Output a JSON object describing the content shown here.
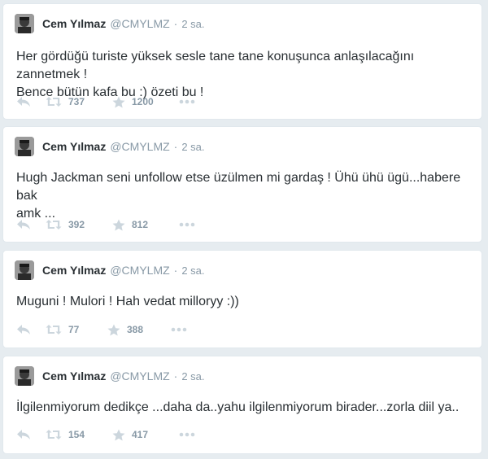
{
  "tweets": [
    {
      "name": "Cem Yılmaz",
      "handle": "@CMYLMZ",
      "separator": "·",
      "time": "2 sa.",
      "text_line1": "Her gördüğü turiste yüksek sesle tane tane konuşunca anlaşılacağını zannetmek !",
      "text_line2": "Bence bütün kafa bu :) özeti bu !",
      "retweets": "737",
      "favorites": "1200"
    },
    {
      "name": "Cem Yılmaz",
      "handle": "@CMYLMZ",
      "separator": "·",
      "time": "2 sa.",
      "text_line1": "Hugh Jackman seni unfollow etse üzülmen mi gardaş ! Ühü ühü ügü...habere bak",
      "text_line2": "amk ...",
      "retweets": "392",
      "favorites": "812"
    },
    {
      "name": "Cem Yılmaz",
      "handle": "@CMYLMZ",
      "separator": "·",
      "time": "2 sa.",
      "text_line1": "Muguni ! Mulori ! Hah vedat milloryy :))",
      "text_line2": "",
      "retweets": "77",
      "favorites": "388"
    },
    {
      "name": "Cem Yılmaz",
      "handle": "@CMYLMZ",
      "separator": "·",
      "time": "2 sa.",
      "text_line1": "İlgilenmiyorum dedikçe ...daha da..yahu ilgilenmiyorum birader...zorla diil ya..",
      "text_line2": "",
      "retweets": "154",
      "favorites": "417"
    }
  ],
  "icons": {
    "avatar": "avatar-photo",
    "reply": "reply-icon",
    "retweet": "retweet-icon",
    "favorite": "star-icon",
    "more": "more-dots-icon"
  },
  "colors": {
    "background": "#e6ecf0",
    "card": "#ffffff",
    "text": "#292f33",
    "muted": "#8899a6",
    "icon": "#ccd6dd"
  }
}
